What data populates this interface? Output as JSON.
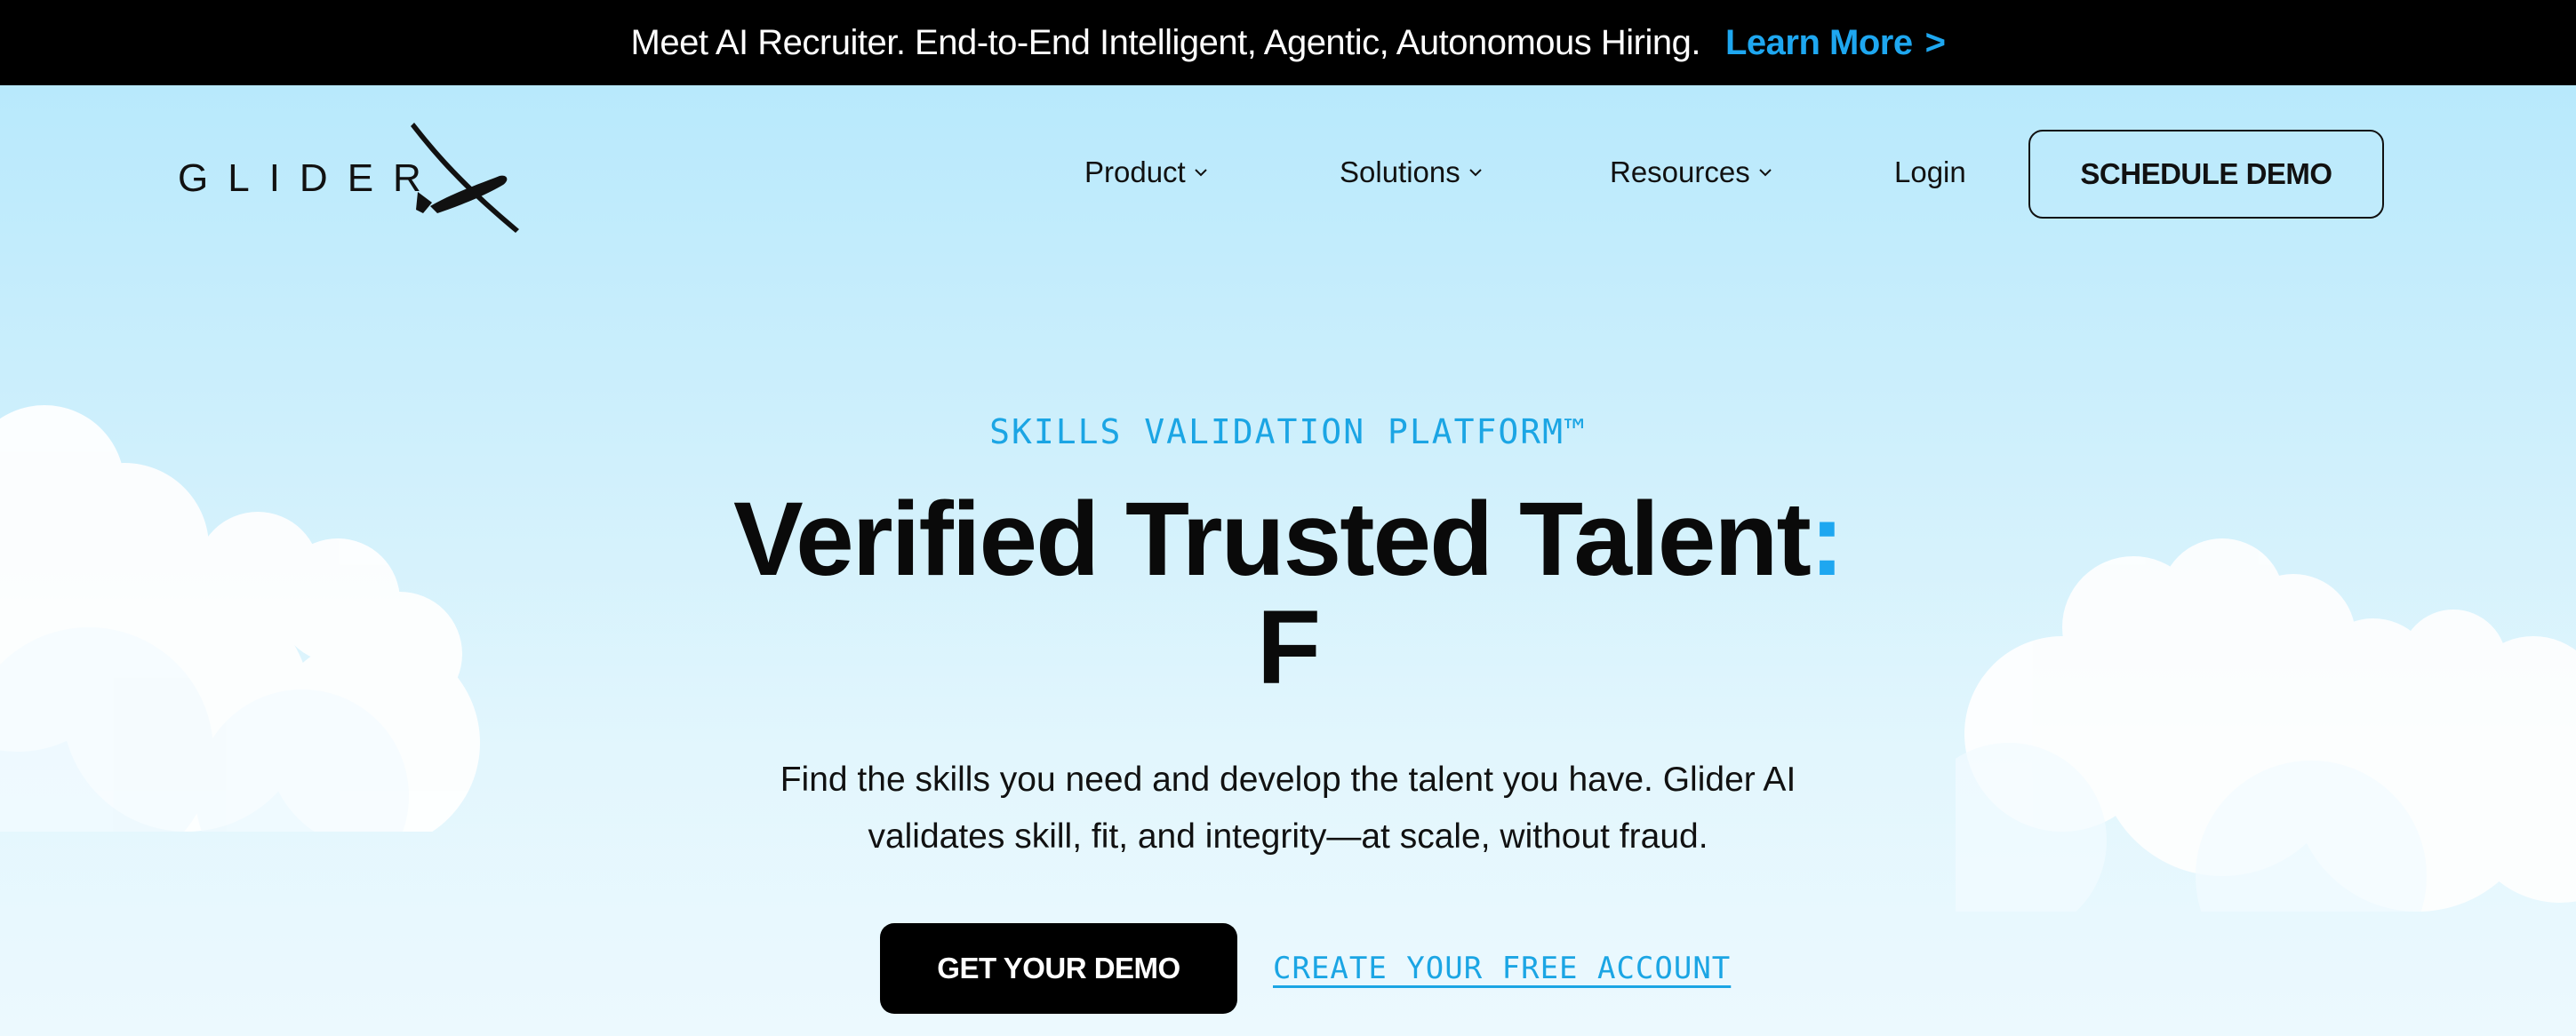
{
  "announcement": {
    "message": "Meet AI Recruiter. End-to-End Intelligent, Agentic, Autonomous Hiring.",
    "link_label": "Learn More",
    "link_chevron": ">"
  },
  "brand": {
    "name": "GLIDER",
    "logo_icon": "glider-plane-icon"
  },
  "nav": {
    "items": [
      {
        "label": "Product",
        "icon": "chevron-down-icon"
      },
      {
        "label": "Solutions",
        "icon": "chevron-down-icon"
      },
      {
        "label": "Resources",
        "icon": "chevron-down-icon"
      },
      {
        "label": "Login"
      }
    ],
    "cta_label": "SCHEDULE DEMO"
  },
  "hero": {
    "eyebrow": "SKILLS VALIDATION PLATFORM™",
    "headline_line1": "Verified Trusted Talent",
    "headline_colon": ":",
    "headline_line2": "F",
    "subhead_line1": "Find the skills you need and develop the talent you have. Glider AI",
    "subhead_line2": "validates skill, fit, and integrity—at scale, without fraud.",
    "primary_cta": "GET YOUR DEMO",
    "secondary_cta": "CREATE YOUR FREE ACCOUNT"
  },
  "colors": {
    "accent": "#1ea7f0",
    "announcement_bg": "#000000",
    "sky_top": "#b8e9fc",
    "sky_bottom": "#ecf9fe",
    "text": "#0a0a0a"
  }
}
